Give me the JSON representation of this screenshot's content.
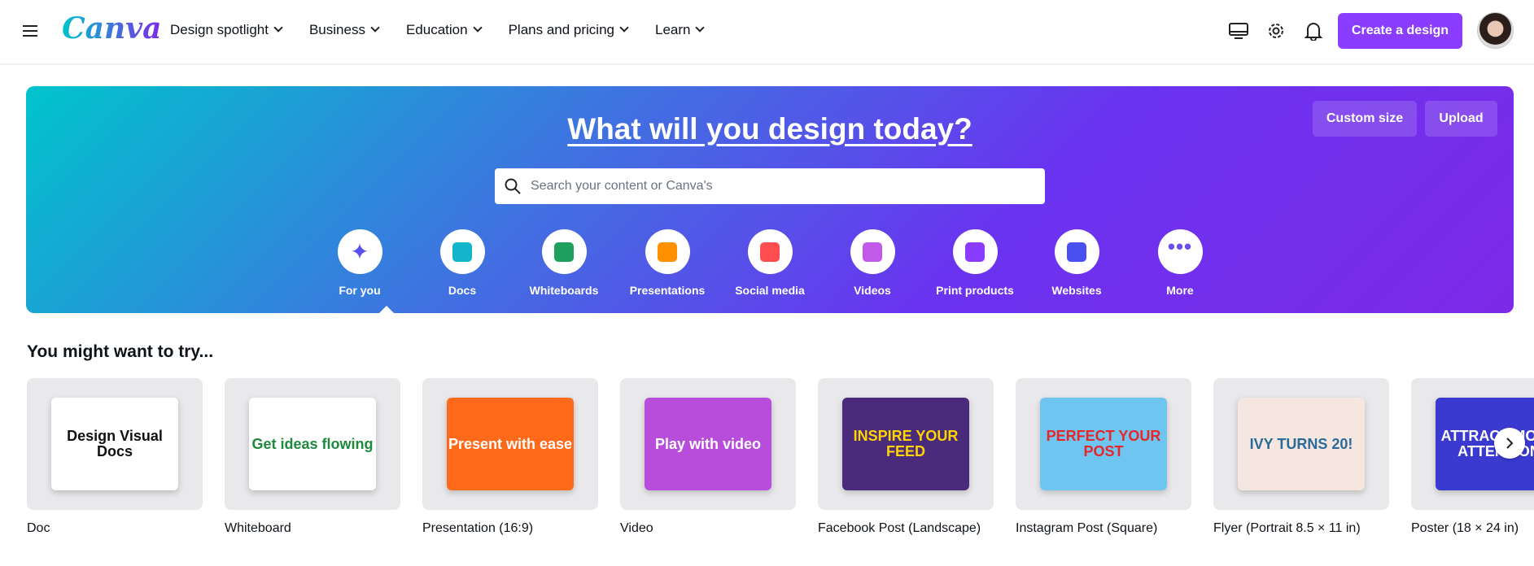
{
  "header": {
    "logo": "Canva",
    "nav": [
      "Design spotlight",
      "Business",
      "Education",
      "Plans and pricing",
      "Learn"
    ],
    "create_label": "Create a design"
  },
  "banner": {
    "title": "What will you design today?",
    "custom_size": "Custom size",
    "upload": "Upload",
    "search_placeholder": "Search your content or Canva's",
    "categories": [
      {
        "label": "For you",
        "icon": "sparkle-icon",
        "color": "#5a4ff0"
      },
      {
        "label": "Docs",
        "icon": "doc-icon",
        "color": "#13b5cb"
      },
      {
        "label": "Whiteboards",
        "icon": "whiteboard-icon",
        "color": "#1ea05f"
      },
      {
        "label": "Presentations",
        "icon": "presentation-icon",
        "color": "#ff9100"
      },
      {
        "label": "Social media",
        "icon": "heart-icon",
        "color": "#ff4e50"
      },
      {
        "label": "Videos",
        "icon": "video-icon",
        "color": "#c05ae8"
      },
      {
        "label": "Print products",
        "icon": "printer-icon",
        "color": "#8b3dff"
      },
      {
        "label": "Websites",
        "icon": "website-icon",
        "color": "#4a4ff0"
      },
      {
        "label": "More",
        "icon": "more-icon",
        "color": "#6a4ff0"
      }
    ]
  },
  "section": {
    "title": "You might want to try..."
  },
  "cards": [
    {
      "label": "Doc",
      "thumb": "Design Visual Docs",
      "bg": "#ffffff",
      "fg": "#111111"
    },
    {
      "label": "Whiteboard",
      "thumb": "Get ideas flowing",
      "bg": "#ffffff",
      "fg": "#1e8a3c"
    },
    {
      "label": "Presentation (16:9)",
      "thumb": "Present with ease",
      "bg": "#ff6a1a",
      "fg": "#ffffff"
    },
    {
      "label": "Video",
      "thumb": "Play with video",
      "bg": "#b84ddb",
      "fg": "#ffffff"
    },
    {
      "label": "Facebook Post (Landscape)",
      "thumb": "INSPIRE YOUR FEED",
      "bg": "#4a2a7a",
      "fg": "#ffd400"
    },
    {
      "label": "Instagram Post (Square)",
      "thumb": "PERFECT YOUR POST",
      "bg": "#6ec6f0",
      "fg": "#e8252a"
    },
    {
      "label": "Flyer (Portrait 8.5 × 11 in)",
      "thumb": "IVY TURNS 20!",
      "bg": "#f6e6e0",
      "fg": "#2a6b9a"
    },
    {
      "label": "Poster (18 × 24 in)",
      "thumb": "ATTRACT MORE ATTENTION",
      "bg": "#3a3ad0",
      "fg": "#ffffff"
    }
  ]
}
